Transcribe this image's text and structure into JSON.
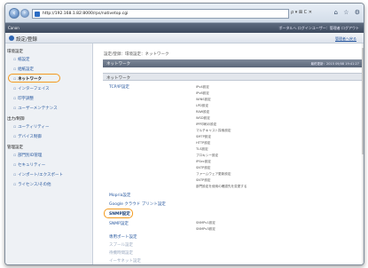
{
  "browser": {
    "url": "http://192.168.1.82:8000/rps/nativetop.cgi",
    "address_tools": "ρ ▾ ⊠ C ✕",
    "back_icon": "back-arrow-icon",
    "forward_icon": "forward-arrow-icon",
    "command_icons": [
      "⌂",
      "☆",
      "⚙"
    ]
  },
  "header": {
    "brand": "Canon",
    "right": "ポータルへ  ログインユーザー：管理者 ログアウト"
  },
  "subheader": {
    "title": "設定/登録",
    "portal_link": "管理者へ戻る"
  },
  "sidebar": {
    "sections": [
      {
        "title": "環境設定",
        "items": [
          "紙設定",
          "給紙設定",
          "ネットワーク",
          "インターフェイス",
          "印字調整",
          "ユーザーメンテナンス"
        ]
      },
      {
        "title": "出力/制御",
        "items": [
          "ユーティリティー",
          "デバイス制御"
        ]
      },
      {
        "title": "管理設定",
        "items": [
          "部門別ID管理",
          "セキュリティー",
          "インポート/エクスポート",
          "ライセンス/その他"
        ]
      }
    ]
  },
  "main": {
    "breadcrumb": "設定/登録：環境設定：ネットワーク",
    "title": "ネットワーク",
    "last_updated": "最終更新：2015 09/08 19:41:27",
    "section": "ネットワーク",
    "tcpip": {
      "label": "TCP/IP設定",
      "items": [
        "IPv4設定",
        "IPv6設定",
        "WINS設定",
        "LPD設定",
        "RAW設定",
        "WSD設定",
        "IPP印刷の設定",
        "マルチキャスト探索設定",
        "SMTP設定",
        "HTTP設定",
        "TLS設定",
        "プロキシー設定",
        "IPSec設定",
        "SNTP設定",
        "ファームウェア更新設定",
        "SNTP設定",
        "部門設定を使用の確認先を変更する"
      ]
    },
    "mopria": "Mopria設定",
    "gcp": "Google クラウド プリント設定",
    "snmp": {
      "label": "SNMP設定",
      "items": [
        "SNMPv1設定",
        "SNMPv3設定"
      ]
    },
    "links_below": [
      "SNMP設定",
      "専用ポート設定",
      "スプール設定",
      "待機時間設定",
      "イーサネット設定"
    ]
  }
}
